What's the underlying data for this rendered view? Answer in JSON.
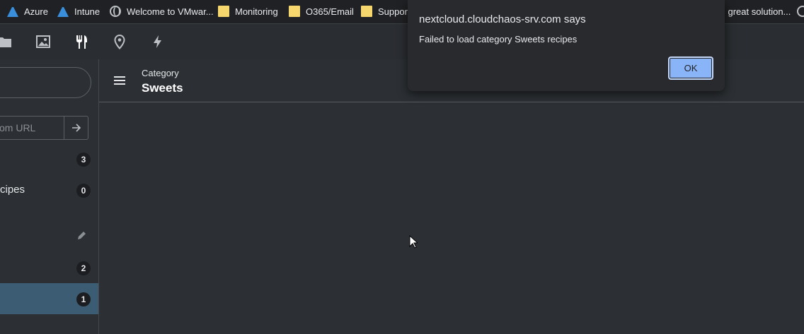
{
  "bookmarks": [
    {
      "label": "Azure",
      "icon": "azure-icon"
    },
    {
      "label": "Intune",
      "icon": "azure-icon"
    },
    {
      "label": "Welcome to VMwar...",
      "icon": "globe-icon"
    },
    {
      "label": "Monitoring",
      "icon": "folder-icon"
    },
    {
      "label": "O365/Email",
      "icon": "folder-icon"
    },
    {
      "label": "Support",
      "icon": "folder-icon"
    },
    {
      "label": "l great solution...",
      "icon": "globe-icon"
    }
  ],
  "appbar": {
    "icons": [
      "files-icon",
      "photos-icon",
      "cookbook-icon",
      "maps-icon",
      "activity-icon"
    ]
  },
  "sidebar": {
    "url_placeholder": "om URL",
    "items": [
      {
        "label": "",
        "count": "3"
      },
      {
        "label": "cipes",
        "count": "0"
      },
      {
        "label": "",
        "action": "edit"
      },
      {
        "label": "",
        "count": "2"
      },
      {
        "label": "",
        "count": "1",
        "active": true
      }
    ]
  },
  "content": {
    "breadcrumb_label": "Category",
    "breadcrumb_title": "Sweets"
  },
  "dialog": {
    "title": "nextcloud.cloudchaos-srv.com says",
    "message": "Failed to load category Sweets recipes",
    "ok_label": "OK"
  },
  "colors": {
    "accent": "#8ab4f8",
    "active_nav": "#3b5c73",
    "background": "#2c3034"
  }
}
